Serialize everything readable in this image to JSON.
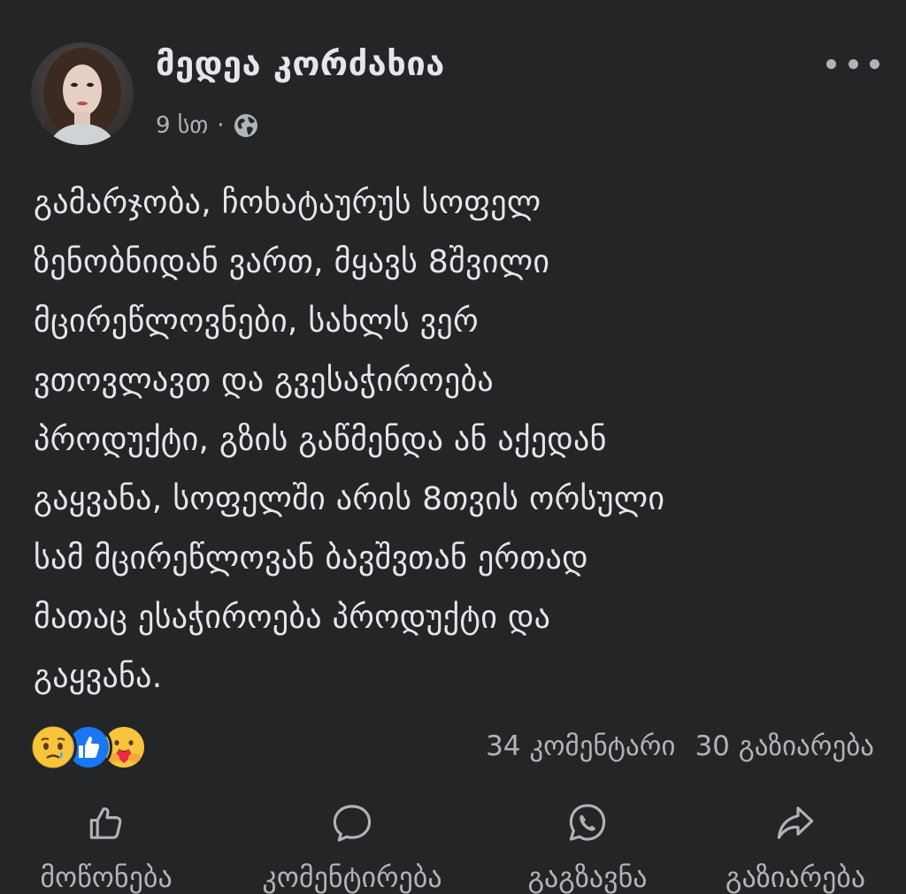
{
  "post": {
    "author": "მედეა კორძახია",
    "time": "9 სთ",
    "separator": "·",
    "privacy_icon": "globe-icon",
    "more_icon": "more-options-icon",
    "text_lines": [
      "გამარჯობა, ჩოხატაურუს სოფელ",
      "ზენობნიდან ვართ, მყავს 8შვილი",
      "მცირეწლოვნები, სახლს ვერ",
      "ვთოვლავთ და გვესაჭიროება",
      "პროდუქტი, გზის გაწმენდა ან აქედან",
      "გაყვანა, სოფელში არის 8თვის ორსული",
      "სამ მცირეწლოვან ბავშვთან ერთად",
      "მათაც ესაჭიროება პროდუქტი და",
      "გაყვანა."
    ]
  },
  "reactions": {
    "icons": [
      "sad-reaction-icon",
      "like-reaction-icon",
      "care-reaction-icon"
    ],
    "comments": "34 კომენტარი",
    "shares": "30 გაზიარება"
  },
  "actions": {
    "like": {
      "label": "მოწონება",
      "icon": "thumbs-up-icon"
    },
    "comment": {
      "label": "კომენტირება",
      "icon": "comment-bubble-icon"
    },
    "send": {
      "label": "გაგზავნა",
      "icon": "whatsapp-icon"
    },
    "share": {
      "label": "გაზიარება",
      "icon": "share-arrow-icon"
    }
  },
  "colors": {
    "background": "#242526",
    "primary_text": "#e4e6eb",
    "secondary_text": "#b0b3b8",
    "like_blue": "#1877f2"
  }
}
